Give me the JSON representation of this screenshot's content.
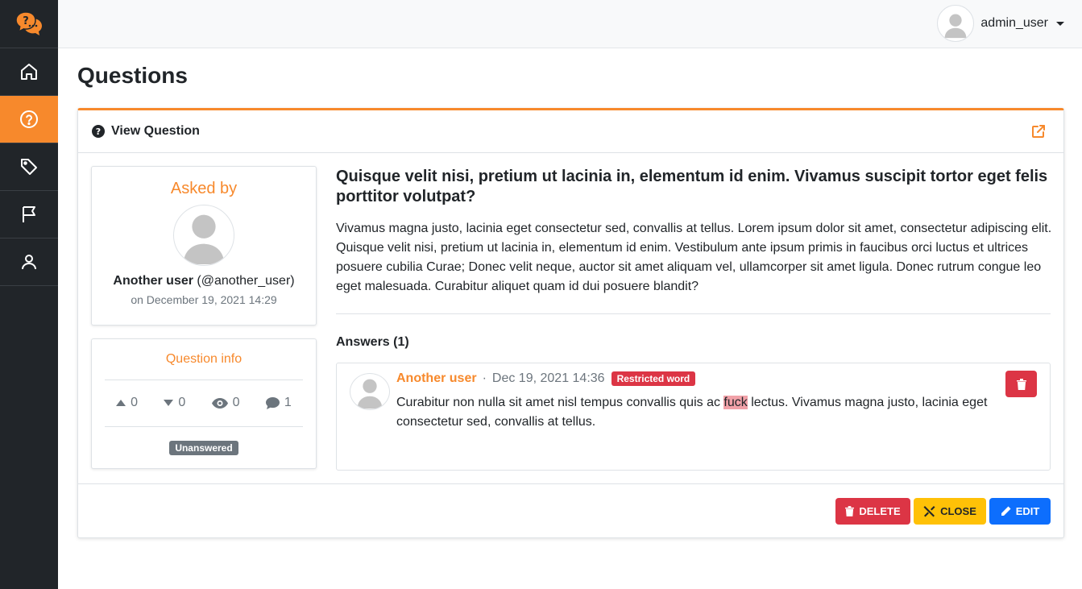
{
  "user": {
    "name": "admin_user"
  },
  "page": {
    "title": "Questions"
  },
  "card": {
    "title": "View Question"
  },
  "asked_by": {
    "title": "Asked by",
    "name": "Another user",
    "username": "(@another_user)",
    "date": "on December 19, 2021 14:29"
  },
  "question_info": {
    "title": "Question info",
    "upvotes": "0",
    "downvotes": "0",
    "views": "0",
    "answers": "1",
    "status": "Unanswered"
  },
  "question": {
    "title": "Quisque velit nisi, pretium ut lacinia in, elementum id enim. Vivamus suscipit tortor eget felis porttitor volutpat?",
    "body": "Vivamus magna justo, lacinia eget consectetur sed, convallis at tellus. Lorem ipsum dolor sit amet, consectetur adipiscing elit. Quisque velit nisi, pretium ut lacinia in, elementum id enim. Vestibulum ante ipsum primis in faucibus orci luctus et ultrices posuere cubilia Curae; Donec velit neque, auctor sit amet aliquam vel, ullamcorper sit amet ligula. Donec rutrum congue leo eget malesuada. Curabitur aliquet quam id dui posuere blandit?"
  },
  "answers": {
    "heading": "Answers (1)",
    "items": [
      {
        "author": "Another user",
        "separator": "·",
        "date": "Dec 19, 2021 14:36",
        "badge": "Restricted word",
        "text_before": "Curabitur non nulla sit amet nisl tempus convallis quis ac ",
        "highlight": "fuck",
        "text_after": " lectus. Vivamus magna justo, lacinia eget consectetur sed, convallis at tellus."
      }
    ]
  },
  "actions": {
    "delete": "DELETE",
    "close": "CLOSE",
    "edit": "EDIT"
  },
  "colors": {
    "accent": "#f7892c",
    "sidebar": "#212529",
    "danger": "#dc3545",
    "warning": "#ffc107",
    "primary": "#0d6efd",
    "secondary": "#6c757d"
  },
  "icons": {
    "logo": "question-chat-icon",
    "nav": [
      "home-icon",
      "question-circle-icon",
      "tag-icon",
      "flag-icon",
      "user-icon"
    ],
    "external": "external-link-icon"
  }
}
